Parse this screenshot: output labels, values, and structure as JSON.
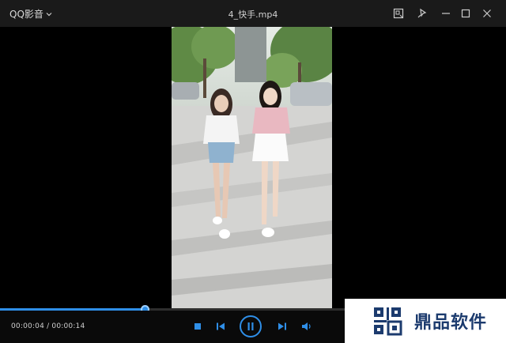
{
  "titlebar": {
    "app_name": "QQ影音",
    "file_name": "4_快手.mp4"
  },
  "playback": {
    "current_time": "00:00:04",
    "total_time": "00:00:14",
    "progress_fraction": 0.286
  },
  "watermark": {
    "text": "鼎品软件"
  },
  "colors": {
    "accent": "#2f8fe8",
    "titlebar_bg": "#1a1a1a",
    "watermark_text": "#1c3b6e"
  }
}
